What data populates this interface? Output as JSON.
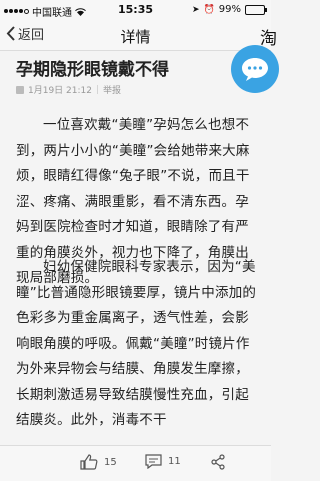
{
  "status": {
    "carrier": "中国联通",
    "time": "15:35",
    "battery": "99%"
  },
  "nav": {
    "back_label": "返回",
    "title": "详情",
    "right_partial": "淘"
  },
  "article": {
    "title": "孕期隐形眼镜戴不得",
    "date": "1月19日 21:12",
    "report": "举报",
    "paragraph1": "一位喜欢戴“美瞳”孕妈怎么也想不到，两片小小的“美瞳”会给她带来大麻烦，眼睛红得像“兔子眼”不说，而且干涩、疼痛、满眼重影，看不清东西。孕妈到医院检查时才知道，眼睛除了有严重的角膜炎外，视力也下降了，角膜出现局部磨损。",
    "paragraph2": "妇幼保健院眼科专家表示，因为“美瞳”比普通隐形眼镜要厚，镜片中添加的色彩多为重金属离子，透气性差，会影响眼角膜的呼吸。佩戴“美瞳”时镜片作为外来异物会与结膜、角膜发生摩擦，长期刺激适易导致结膜慢性充血，引起结膜炎。此外，消毒不干"
  },
  "bottom": {
    "likes": "15",
    "comments": "11"
  },
  "colors": {
    "accent": "#3aa3e3"
  }
}
